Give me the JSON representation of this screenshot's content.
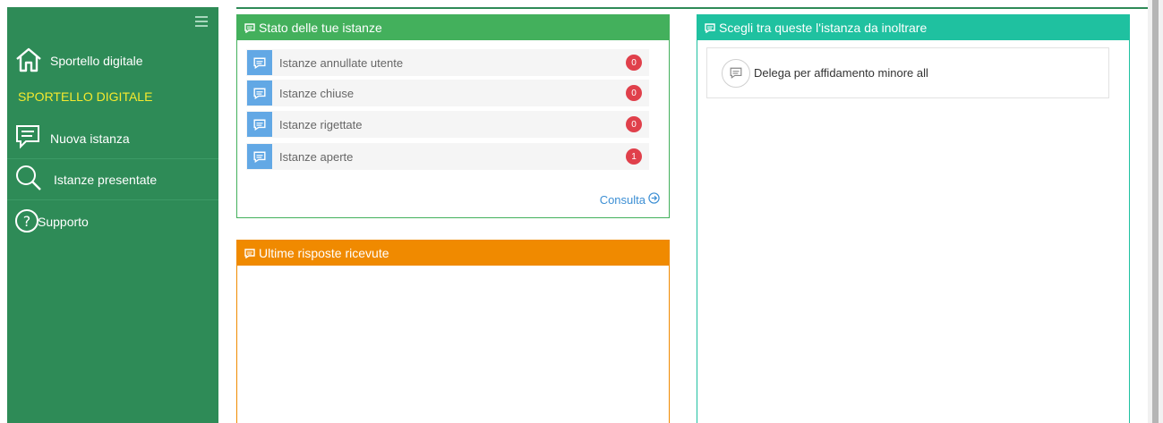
{
  "sidebar": {
    "menu_icon": "hamburger-icon",
    "home_label": "Sportello digitale",
    "section_heading": "SPORTELLO DIGITALE",
    "items": [
      {
        "label": "Nuova istanza",
        "icon": "chat-icon"
      },
      {
        "label": "Istanze presentate",
        "icon": "search-icon"
      },
      {
        "label": "Supporto",
        "icon": "help-icon"
      }
    ]
  },
  "status_panel": {
    "title": "Stato delle tue istanze",
    "rows": [
      {
        "label": "Istanze annullate utente",
        "count": "0"
      },
      {
        "label": "Istanze chiuse",
        "count": "0"
      },
      {
        "label": "Istanze rigettate",
        "count": "0"
      },
      {
        "label": "Istanze aperte",
        "count": "1"
      }
    ],
    "link_label": "Consulta"
  },
  "responses_panel": {
    "title": "Ultime risposte ricevute"
  },
  "choose_panel": {
    "title": "Scegli tra queste l'istanza da inoltrare",
    "options": [
      {
        "label": "Delega per affidamento minore all"
      }
    ]
  },
  "colors": {
    "sidebar": "#2e8b57",
    "status_header": "#43b05c",
    "responses_header": "#f08a00",
    "choose_header": "#1fc1a0",
    "badge": "#e0404b",
    "heading_yellow": "#f5ea2e"
  }
}
